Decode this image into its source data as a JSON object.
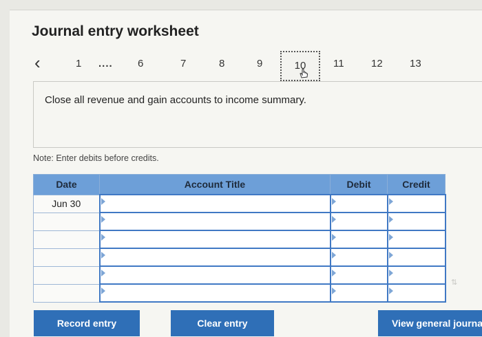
{
  "worksheet": {
    "title": "Journal entry worksheet",
    "pager": {
      "prev_icon": "chevron-left-icon",
      "pages": [
        "1",
        "....",
        "6",
        "7",
        "8",
        "9",
        "10",
        "11",
        "12",
        "13"
      ],
      "active_page": "10"
    },
    "prompt": "Close all revenue and gain accounts to income summary.",
    "note": "Note: Enter debits before credits."
  },
  "journal": {
    "headers": {
      "date": "Date",
      "account": "Account Title",
      "debit": "Debit",
      "credit": "Credit"
    },
    "rows": [
      {
        "date": "Jun 30",
        "account": "",
        "debit": "",
        "credit": ""
      },
      {
        "date": "",
        "account": "",
        "debit": "",
        "credit": ""
      },
      {
        "date": "",
        "account": "",
        "debit": "",
        "credit": ""
      },
      {
        "date": "",
        "account": "",
        "debit": "",
        "credit": ""
      },
      {
        "date": "",
        "account": "",
        "debit": "",
        "credit": ""
      },
      {
        "date": "",
        "account": "",
        "debit": "",
        "credit": ""
      }
    ]
  },
  "buttons": {
    "record": "Record entry",
    "clear": "Clear entry",
    "view": "View general journal"
  },
  "colors": {
    "header_bg": "#6d9fd8",
    "button_bg": "#2f6fb7",
    "input_border": "#3f78c4"
  }
}
